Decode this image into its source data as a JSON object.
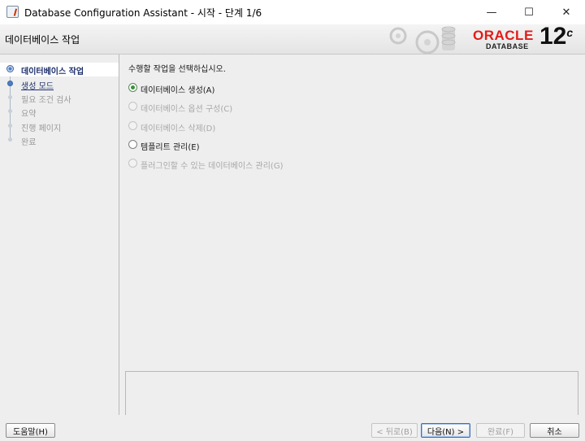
{
  "window": {
    "title": "Database Configuration Assistant - 시작 - 단계 1/6",
    "minimize_glyph": "—",
    "maximize_glyph": "☐",
    "close_glyph": "✕"
  },
  "header": {
    "page_title": "데이터베이스 작업",
    "brand": "ORACLE",
    "brand_sub": "DATABASE",
    "version": "12",
    "version_suffix": "c",
    "brand_color": "#e41b17"
  },
  "steps": [
    {
      "label": "데이터베이스 작업",
      "state": "active"
    },
    {
      "label": "생성 모드",
      "state": "link"
    },
    {
      "label": "필요 조건 검사",
      "state": "disabled"
    },
    {
      "label": "요약",
      "state": "disabled"
    },
    {
      "label": "진행 페이지",
      "state": "disabled"
    },
    {
      "label": "완료",
      "state": "disabled"
    }
  ],
  "main": {
    "instruction": "수행할 작업을 선택하십시오.",
    "options": [
      {
        "label": "데이터베이스 생성(A)",
        "checked": true,
        "enabled": true
      },
      {
        "label": "데이터베이스 옵션 구성(C)",
        "checked": false,
        "enabled": false
      },
      {
        "label": "데이터베이스 삭제(D)",
        "checked": false,
        "enabled": false
      },
      {
        "label": "템플리트 관리(E)",
        "checked": false,
        "enabled": true
      },
      {
        "label": "플러그인할 수 있는 데이터베이스 관리(G)",
        "checked": false,
        "enabled": false
      }
    ]
  },
  "buttons": {
    "help": "도움말(H)",
    "back": "< 뒤로(B)",
    "next": "다음(N) >",
    "finish": "완료(F)",
    "cancel": "취소"
  }
}
